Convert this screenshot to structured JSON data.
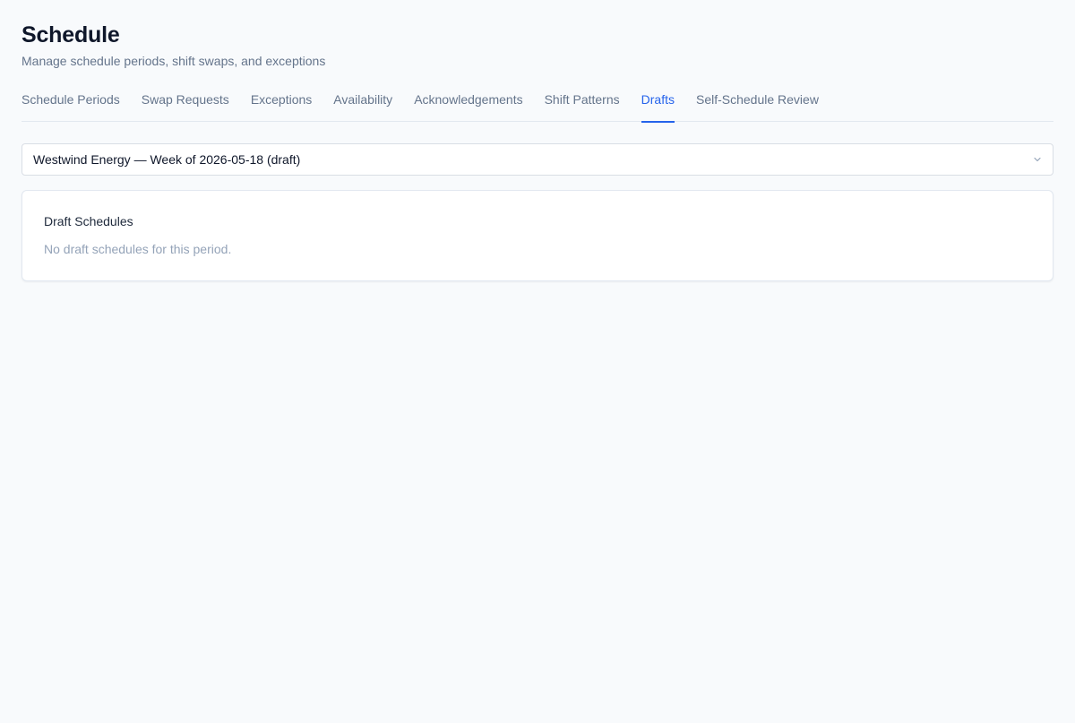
{
  "header": {
    "title": "Schedule",
    "subtitle": "Manage schedule periods, shift swaps, and exceptions"
  },
  "tabs": [
    {
      "label": "Schedule Periods",
      "active": false
    },
    {
      "label": "Swap Requests",
      "active": false
    },
    {
      "label": "Exceptions",
      "active": false
    },
    {
      "label": "Availability",
      "active": false
    },
    {
      "label": "Acknowledgements",
      "active": false
    },
    {
      "label": "Shift Patterns",
      "active": false
    },
    {
      "label": "Drafts",
      "active": true
    },
    {
      "label": "Self-Schedule Review",
      "active": false
    }
  ],
  "period_select": {
    "selected": "Westwind Energy — Week of 2026-05-18 (draft)",
    "icon": "chevron-down-icon"
  },
  "drafts_card": {
    "title": "Draft Schedules",
    "empty_message": "No draft schedules for this period."
  },
  "colors": {
    "accent": "#2563eb",
    "background": "#f8fafc",
    "muted_text": "#64748b",
    "placeholder_text": "#94a3b8"
  }
}
